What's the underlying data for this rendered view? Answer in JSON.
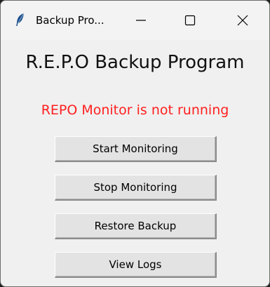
{
  "window": {
    "title": "Backup Pro...",
    "icon": "feather-icon"
  },
  "controls": {
    "minimize": "minimize-icon",
    "maximize": "maximize-icon",
    "close": "close-icon"
  },
  "main": {
    "heading": "R.E.P.O Backup Program",
    "status": "REPO Monitor is not running",
    "status_color": "#ff2020"
  },
  "buttons": {
    "start": "Start Monitoring",
    "stop": "Stop Monitoring",
    "restore": "Restore Backup",
    "logs": "View Logs"
  }
}
